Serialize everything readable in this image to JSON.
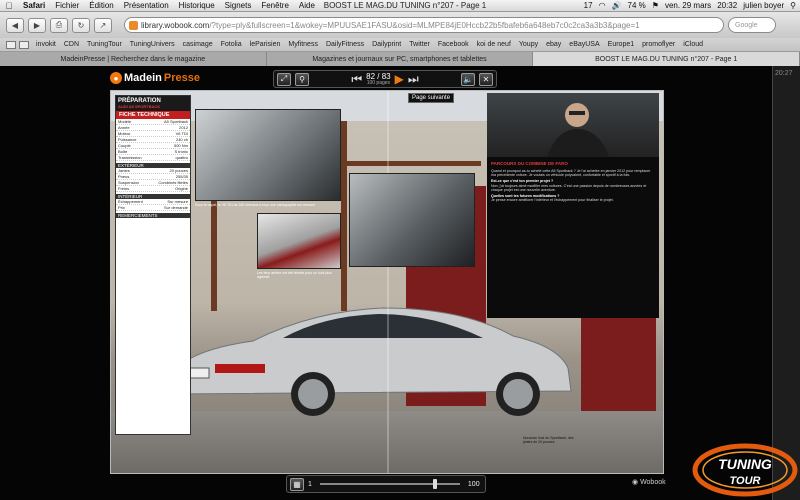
{
  "menubar": {
    "app": "Safari",
    "items": [
      "Fichier",
      "Édition",
      "Présentation",
      "Historique",
      "Signets",
      "Fenêtre",
      "Aide"
    ],
    "window_title": "BOOST LE MAG.DU TUNING n°207 - Page 1",
    "status": {
      "notif_count": "17",
      "battery": "74 %",
      "date": "ven. 29 mars",
      "time": "20:32",
      "user": "julien boyer"
    }
  },
  "toolbar": {
    "url_host": "library.wobook.com",
    "url_path": "/?type=ply&fullscreen=1&wokey=MPUUSAE1FASU&osid=MLMPE84jE0Hccb22b5fbafeb6a648eb7c0c2ca3a3b3&page=1",
    "search_placeholder": "Google"
  },
  "bookmarks": [
    "invokit",
    "CDN",
    "TuningTour",
    "TuningUnivers",
    "casimage",
    "Fotolia",
    "leParisien",
    "Myfitness",
    "DailyFitness",
    "Dailyprint",
    "Twitter",
    "Facebook",
    "koi de neuf",
    "Youpy",
    "ebay",
    "eBayUSA",
    "Europe1",
    "promoflyer",
    "iCloud"
  ],
  "tabs": [
    {
      "label": "MadeinPresse | Recherchez dans le magazine",
      "active": false
    },
    {
      "label": "Magazines et journaux sur PC, smartphones et tablettes",
      "active": false
    },
    {
      "label": "BOOST LE MAG.DU TUNING n°207 - Page 1",
      "active": true
    }
  ],
  "viewer": {
    "brand_made": "Madein",
    "brand_press": "Presse",
    "page_current": "82 / 83",
    "page_sub": "100 pages",
    "next_page_label": "Page suivante",
    "slider_min": "1",
    "slider_max": "100",
    "slider_position": 0.83,
    "wobook_label": "Wobook",
    "right_time": "20:27"
  },
  "magazine": {
    "fiche_title": "PRÉPARATION",
    "fiche_sub": "AUDI A5 SPORTBACK",
    "fiche_band": "FICHE TECHNIQUE",
    "fiche_rows": [
      [
        "Modèle",
        "A5 Sportback"
      ],
      [
        "Année",
        "2012"
      ],
      [
        "Moteur",
        "V6 TDI"
      ],
      [
        "Puissance",
        "240 ch"
      ],
      [
        "Couple",
        "500 Nm"
      ],
      [
        "Boîte",
        "S tronic"
      ],
      [
        "Transmission",
        "quattro"
      ],
      [
        "Jantes",
        "20 pouces"
      ],
      [
        "Pneus",
        "255/35"
      ],
      [
        "Suspension",
        "Combinés filetés"
      ],
      [
        "Freins",
        "Origine"
      ],
      [
        "Échappement",
        "Sur mesure"
      ],
      [
        "Prix",
        "Sur demande"
      ]
    ],
    "fiche_sections": [
      "EXTÉRIEUR",
      "INTÉRIEUR",
      "REMERCIEMENTS"
    ],
    "article_title": "PARCOURS DU COMBINE DE FARO",
    "article_body": "Quand et pourquoi as-tu acheté cette A5 Sportback ? Je l'ai achetée en janvier 2012 pour remplacer ma précédente voiture. Je voulais un véhicule polyvalent, confortable et sportif à la fois.",
    "article_q2": "Est-ce que c'est ton premier projet ?",
    "article_body2": "Non, j'ai toujours aimé modifier mes voitures. C'est une passion depuis de nombreuses années et chaque projet est une nouvelle aventure.",
    "article_q3": "Quelles sont tes futures modifications ?",
    "article_body3": "Je pense encore améliorer l'intérieur et l'échappement pour finaliser le projet.",
    "photo_caption_left": "Sous le capot, le V6 TDI de 240 chevaux a reçu une cartographie sur mesure.",
    "photo_caption_mid": "Les feux arrière ont été teintés pour un look plus agressif.",
    "photo_caption_bottom": "Nouveau look du Sportback, des jantes de 20 pouces."
  },
  "watermark": {
    "top": "TUNING",
    "bottom": "TOUR"
  },
  "colors": {
    "accent": "#f07a0e",
    "brand_red": "#c21f1f",
    "viewer_bg": "#050505"
  }
}
